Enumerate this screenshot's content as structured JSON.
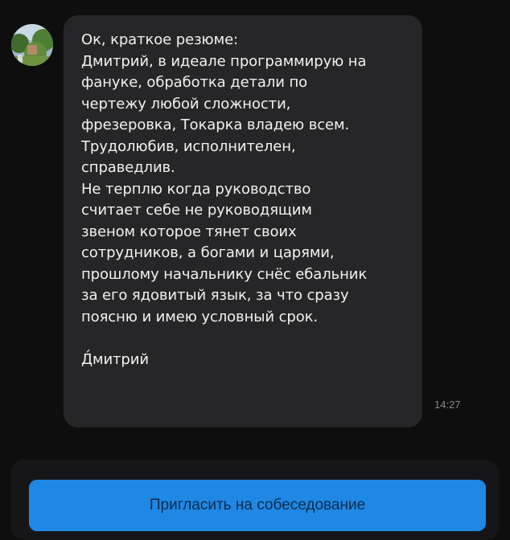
{
  "message": {
    "lines": [
      "Ок, краткое резюме:",
      "Дмитрий, в идеале программирую на",
      "фануке, обработка детали по",
      "чертежу любой сложности,",
      "фрезеровка, Токарка владею всем.",
      "Трудолюбив, исполнителен,",
      "справедлив.",
      "Не терплю когда руководство",
      "считает себе не руководящим",
      "звеном которое тянет своих",
      "сотрудников, а богами и царями,",
      "прошлому начальнику снёс ебальник",
      "за его ядовитый язык, за что сразу",
      "поясню и имею условный срок."
    ],
    "signature": "Д́митрий",
    "time": "14:27"
  },
  "actions": {
    "invite_label": "Пригласить на собеседование"
  },
  "colors": {
    "background": "#0e0e0e",
    "bubble": "#262628",
    "button": "#1f88e5",
    "button_text": "#0b2a4a"
  }
}
